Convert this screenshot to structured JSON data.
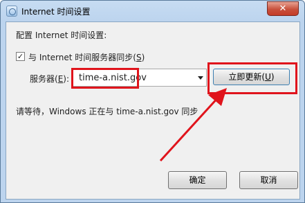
{
  "window": {
    "title": "Internet 时间设置",
    "close_label": "✕"
  },
  "dialog": {
    "heading": "配置 Internet 时间设置:",
    "sync_checkbox": {
      "checked": true,
      "check_mark": "✓",
      "label_prefix": "与 Internet 时间服务器同步(",
      "label_key": "S",
      "label_suffix": ")"
    },
    "server_label_prefix": "服务器(",
    "server_label_key": "E",
    "server_label_suffix": "):",
    "server_value": "time-a.nist.gov",
    "update_button": {
      "prefix": "立即更新(",
      "key": "U",
      "suffix": ")"
    },
    "status_text": "请等待，Windows 正在与 time-a.nist.gov 同步",
    "ok_button": "确定",
    "cancel_button": "取消"
  },
  "colors": {
    "highlight": "#e0141c",
    "title_bar": "#bcd4ee",
    "content_bg": "#f0f0f0"
  }
}
